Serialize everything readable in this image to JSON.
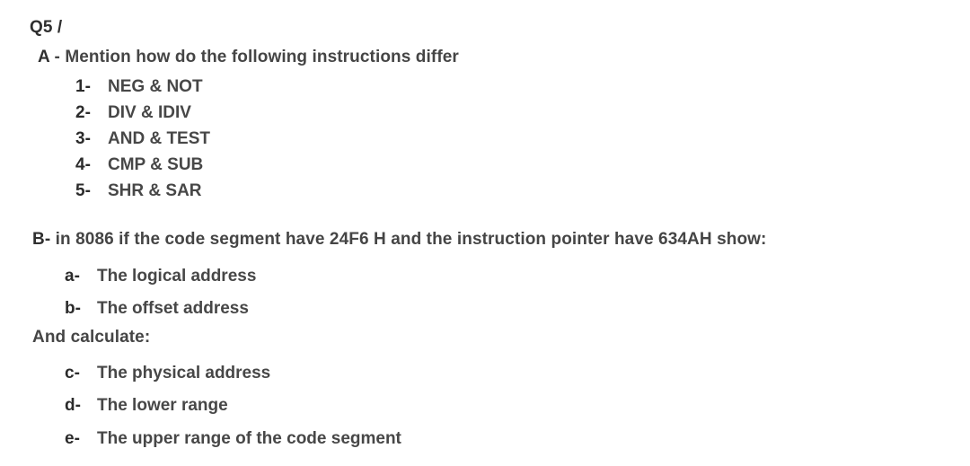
{
  "document": {
    "heading": "Q5 /",
    "ink_color": "#3c3c3c",
    "background_color": "#ffffff",
    "sections": [
      {
        "marker": "A",
        "separator": " - ",
        "prompt": "Mention how do the following instructions differ",
        "items": [
          {
            "marker": "1-",
            "label": "NEG & NOT"
          },
          {
            "marker": "2-",
            "label": "DIV & IDIV"
          },
          {
            "marker": "3-",
            "label": "AND & TEST"
          },
          {
            "marker": "4-",
            "label": "CMP & SUB"
          },
          {
            "marker": "5-",
            "label": "SHR & SAR"
          }
        ]
      },
      {
        "marker": "B-",
        "separator": " ",
        "prompt": "in 8086 if the code segment have 24F6 H and the instruction pointer have 634AH show:",
        "items": [
          {
            "marker": "a-",
            "label": "The logical address"
          },
          {
            "marker": "b-",
            "label": "The offset address"
          }
        ]
      },
      {
        "marker": "",
        "separator": "",
        "prompt": "And calculate:",
        "items": [
          {
            "marker": "c-",
            "label": "The physical address"
          },
          {
            "marker": "d-",
            "label": "The lower range"
          },
          {
            "marker": "e-",
            "label": "The upper range of the code segment"
          }
        ]
      }
    ]
  }
}
